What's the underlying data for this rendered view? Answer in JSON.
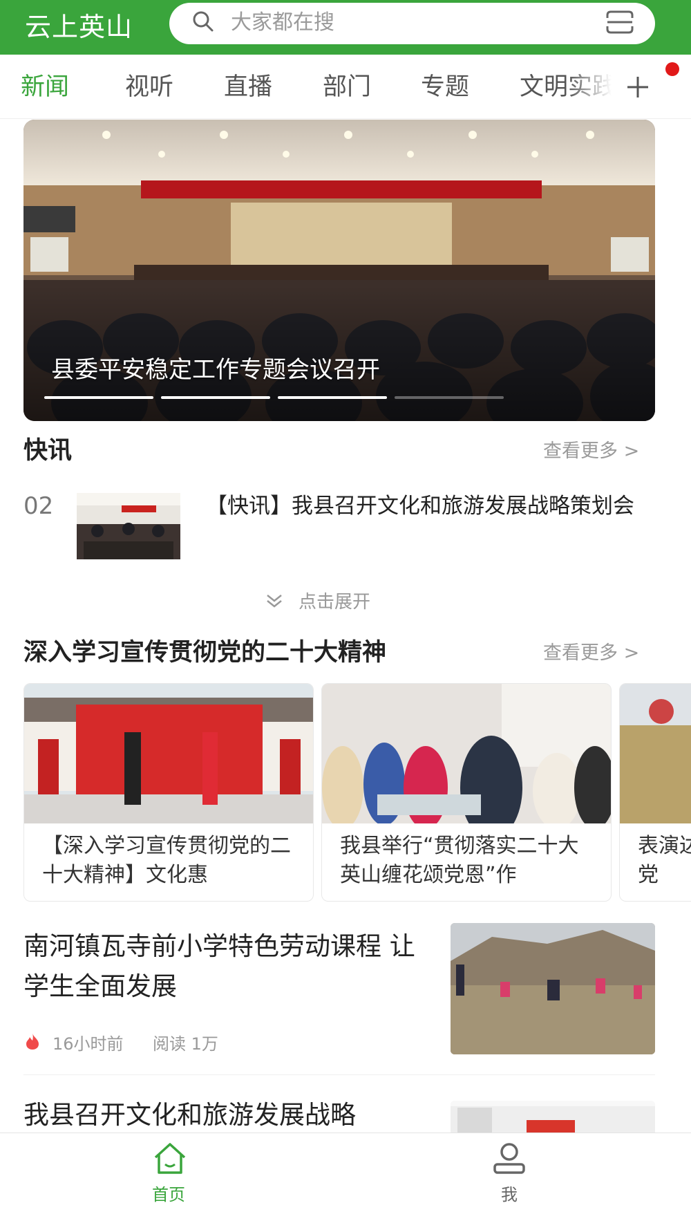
{
  "header": {
    "app_title": "云上英山",
    "search_placeholder": "大家都在搜"
  },
  "tabs": [
    {
      "label": "新闻",
      "active": true
    },
    {
      "label": "视听"
    },
    {
      "label": "直播"
    },
    {
      "label": "部门"
    },
    {
      "label": "专题"
    },
    {
      "label": "文明实践"
    }
  ],
  "banner": {
    "caption": "县委平安稳定工作专题会议召开",
    "slide_count": 4,
    "active_slide": 3
  },
  "flash": {
    "title": "快讯",
    "more": "查看更多 >",
    "index": "02",
    "headline": "【快讯】我县召开文化和旅游发展战略策划会",
    "expand": "点击展开"
  },
  "topic": {
    "title": "深入学习宣传贯彻党的二十大精神",
    "more": "查看更多 >",
    "cards": [
      {
        "text": "【深入学习宣传贯彻党的二十大精神】文化惠"
      },
      {
        "text": "我县举行“贯彻落实二十大 英山缠花颂党恩”作"
      },
      {
        "text": "表演达党"
      }
    ]
  },
  "articles": [
    {
      "title": "南河镇瓦寺前小学特色劳动课程  让学生全面发展",
      "time": "16小时前",
      "reads": "阅读  1万"
    },
    {
      "title": "我县召开文化和旅游发展战略"
    }
  ],
  "bottom_nav": [
    {
      "label": "首页",
      "active": true
    },
    {
      "label": "我"
    }
  ],
  "colors": {
    "brand": "#3aa53c",
    "notification": "#e11919"
  }
}
